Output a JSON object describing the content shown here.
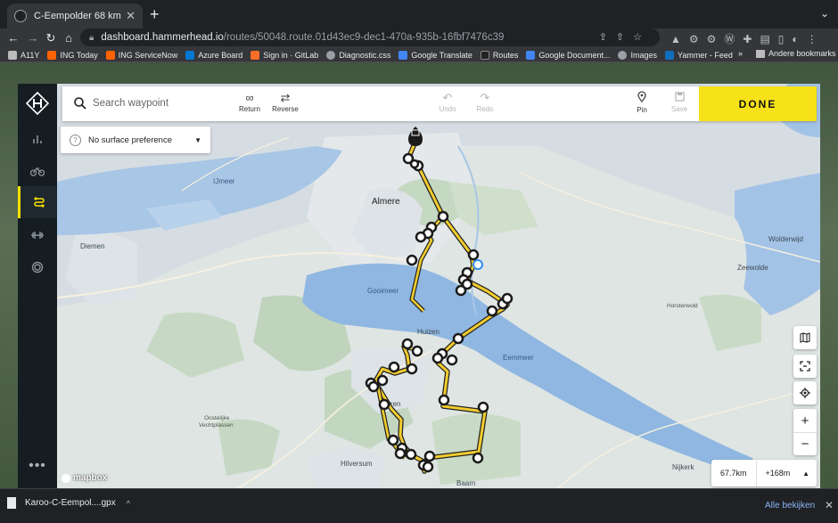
{
  "browser": {
    "tab_title": "C-Eempolder 68 km",
    "tab_close": "✕",
    "new_tab": "+",
    "url_host": "dashboard.hammerhead.io",
    "url_path": "/routes/50048.route.01d43ec9-dec1-470a-935b-16fbf7476c39",
    "bookmarks": [
      {
        "label": "A11Y",
        "color": "#bbbbbb"
      },
      {
        "label": "ING Today",
        "color": "#ff6200"
      },
      {
        "label": "ING ServiceNow",
        "color": "#ff6200"
      },
      {
        "label": "Azure Board",
        "color": "#0078d4"
      },
      {
        "label": "Sign in · GitLab",
        "color": "#fc6d26"
      },
      {
        "label": "Diagnostic.css",
        "color": "#9aa0a6"
      },
      {
        "label": "Google Translate",
        "color": "#4285f4"
      },
      {
        "label": "Routes",
        "color": "#222222"
      },
      {
        "label": "Google Document...",
        "color": "#4285f4"
      },
      {
        "label": "Images",
        "color": "#9aa0a6"
      },
      {
        "label": "Yammer - Feed",
        "color": "#106ebe"
      }
    ],
    "bookmarks_more": "»",
    "other_bookmarks": "Andere bookmarks"
  },
  "app": {
    "search": {
      "placeholder": "Search waypoint"
    },
    "tools": {
      "return": "Return",
      "reverse": "Reverse",
      "undo": "Undo",
      "redo": "Redo",
      "pin": "Pin",
      "save": "Save"
    },
    "done_label": "DONE",
    "surface": {
      "label": "No surface preference"
    },
    "stats": {
      "distance": "67.7km",
      "elevation": "+168m"
    },
    "more": "•••",
    "attribution": "mapbox",
    "accent_color": "#f7e118"
  },
  "map_labels": {
    "ijmeer": "IJmeer",
    "almere": "Almere",
    "diemen": "Diemen",
    "gooimeer": "Gooimeer",
    "huizen": "Huizen",
    "eemmeer": "Eemmeer",
    "laren": "Laren",
    "hilversum": "Hilversum",
    "baarn": "Baarn",
    "nijkerk": "Nijkerk",
    "wolderwijd": "Wolderwijd",
    "zeewolde": "Zeewolde",
    "horsterwold": "Horsterwold",
    "oostelijke": "Oostelijke",
    "vechtplassen": "Vechtplassen"
  },
  "downloads": {
    "file": "Karoo-C-Eempol....gpx",
    "show_all": "Alle bekijken"
  }
}
